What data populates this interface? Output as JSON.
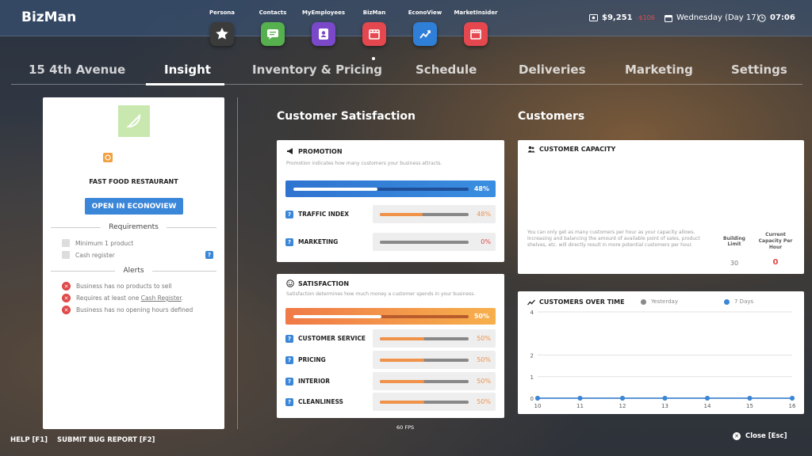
{
  "app": {
    "brand": "BizMan"
  },
  "apps": [
    {
      "label": "Persona",
      "icon": "star-icon",
      "color": "#3b3b3b"
    },
    {
      "label": "Contacts",
      "icon": "chat-icon",
      "color": "#56b04e"
    },
    {
      "label": "MyEmployees",
      "icon": "badge-icon",
      "color": "#7a48c8"
    },
    {
      "label": "BizMan",
      "icon": "store-icon",
      "color": "#e5474f"
    },
    {
      "label": "EconoView",
      "icon": "trend-icon",
      "color": "#2f7fd8"
    },
    {
      "label": "MarketInsider",
      "icon": "market-icon",
      "color": "#e5474f"
    }
  ],
  "status": {
    "money": "$9,251",
    "money_delta": "-$106",
    "date": "Wednesday (Day 17)",
    "time": "07:06"
  },
  "tabs": [
    "15 4th Avenue",
    "Insight",
    "Inventory & Pricing",
    "Schedule",
    "Deliveries",
    "Marketing",
    "Settings"
  ],
  "business": {
    "type": "FAST FOOD RESTAURANT",
    "open_button": "OPEN IN ECONOVIEW",
    "requirements_title": "Requirements",
    "requirements": [
      "Minimum 1 product",
      "Cash register"
    ],
    "alerts_title": "Alerts",
    "alerts": [
      {
        "prefix": "Business has no products to sell",
        "link": "",
        "suffix": ""
      },
      {
        "prefix": "Requires at least one ",
        "link": "Cash Register",
        "suffix": "."
      },
      {
        "prefix": "Business has no opening hours defined",
        "link": "",
        "suffix": ""
      }
    ]
  },
  "satisfaction_section": {
    "title": "Customer Satisfaction",
    "promotion": {
      "title": "PROMOTION",
      "desc": "Promotion indicates how many customers your business attracts.",
      "value_label": "48%",
      "value": 0.48,
      "rows": [
        {
          "label": "TRAFFIC INDEX",
          "pct": "48%",
          "value": 0.48,
          "color": "#f0924a"
        },
        {
          "label": "MARKETING",
          "pct": "0%",
          "value": 0,
          "color": "#e04848"
        }
      ]
    },
    "satisfaction": {
      "title": "SATISFACTION",
      "desc": "Satisfaction determines how much money a customer spends in your business.",
      "value_label": "50%",
      "value": 0.5,
      "rows": [
        {
          "label": "CUSTOMER SERVICE",
          "pct": "50%",
          "value": 0.5
        },
        {
          "label": "PRICING",
          "pct": "50%",
          "value": 0.5
        },
        {
          "label": "INTERIOR",
          "pct": "50%",
          "value": 0.5
        },
        {
          "label": "CLEANLINESS",
          "pct": "50%",
          "value": 0.5
        }
      ]
    }
  },
  "customers_section": {
    "title": "Customers",
    "capacity": {
      "title": "CUSTOMER CAPACITY",
      "desc": "You can only get as many customers per hour as your capacity allows. Increasing and balancing the amount of available point of sales, product shelves, etc. will directly result in more potential customers per hour.",
      "building_limit_label": "Building Limit",
      "building_limit": "30",
      "current_label": "Current Capacity Per Hour",
      "current": "0"
    },
    "over_time": {
      "title": "CUSTOMERS OVER TIME",
      "legend_yesterday": "Yesterday",
      "legend_7days": "7 Days"
    }
  },
  "chart_data": {
    "type": "line",
    "title": "CUSTOMERS OVER TIME",
    "x": [
      10,
      11,
      12,
      13,
      14,
      15,
      16
    ],
    "yticks": [
      0,
      1,
      2,
      4
    ],
    "ylim": [
      0,
      4
    ],
    "series": [
      {
        "name": "Yesterday",
        "values": [
          0,
          0,
          0,
          0,
          0,
          0,
          0
        ],
        "color": "#8a8a8a"
      },
      {
        "name": "7 Days",
        "values": [
          0,
          0,
          0,
          0,
          0,
          0,
          0
        ],
        "color": "#3a86d8"
      }
    ],
    "legend": "top"
  },
  "footer": {
    "help": "HELP [F1]",
    "bug": "SUBMIT BUG REPORT [F2]",
    "fps": "60 FPS",
    "close": "Close [Esc]"
  }
}
